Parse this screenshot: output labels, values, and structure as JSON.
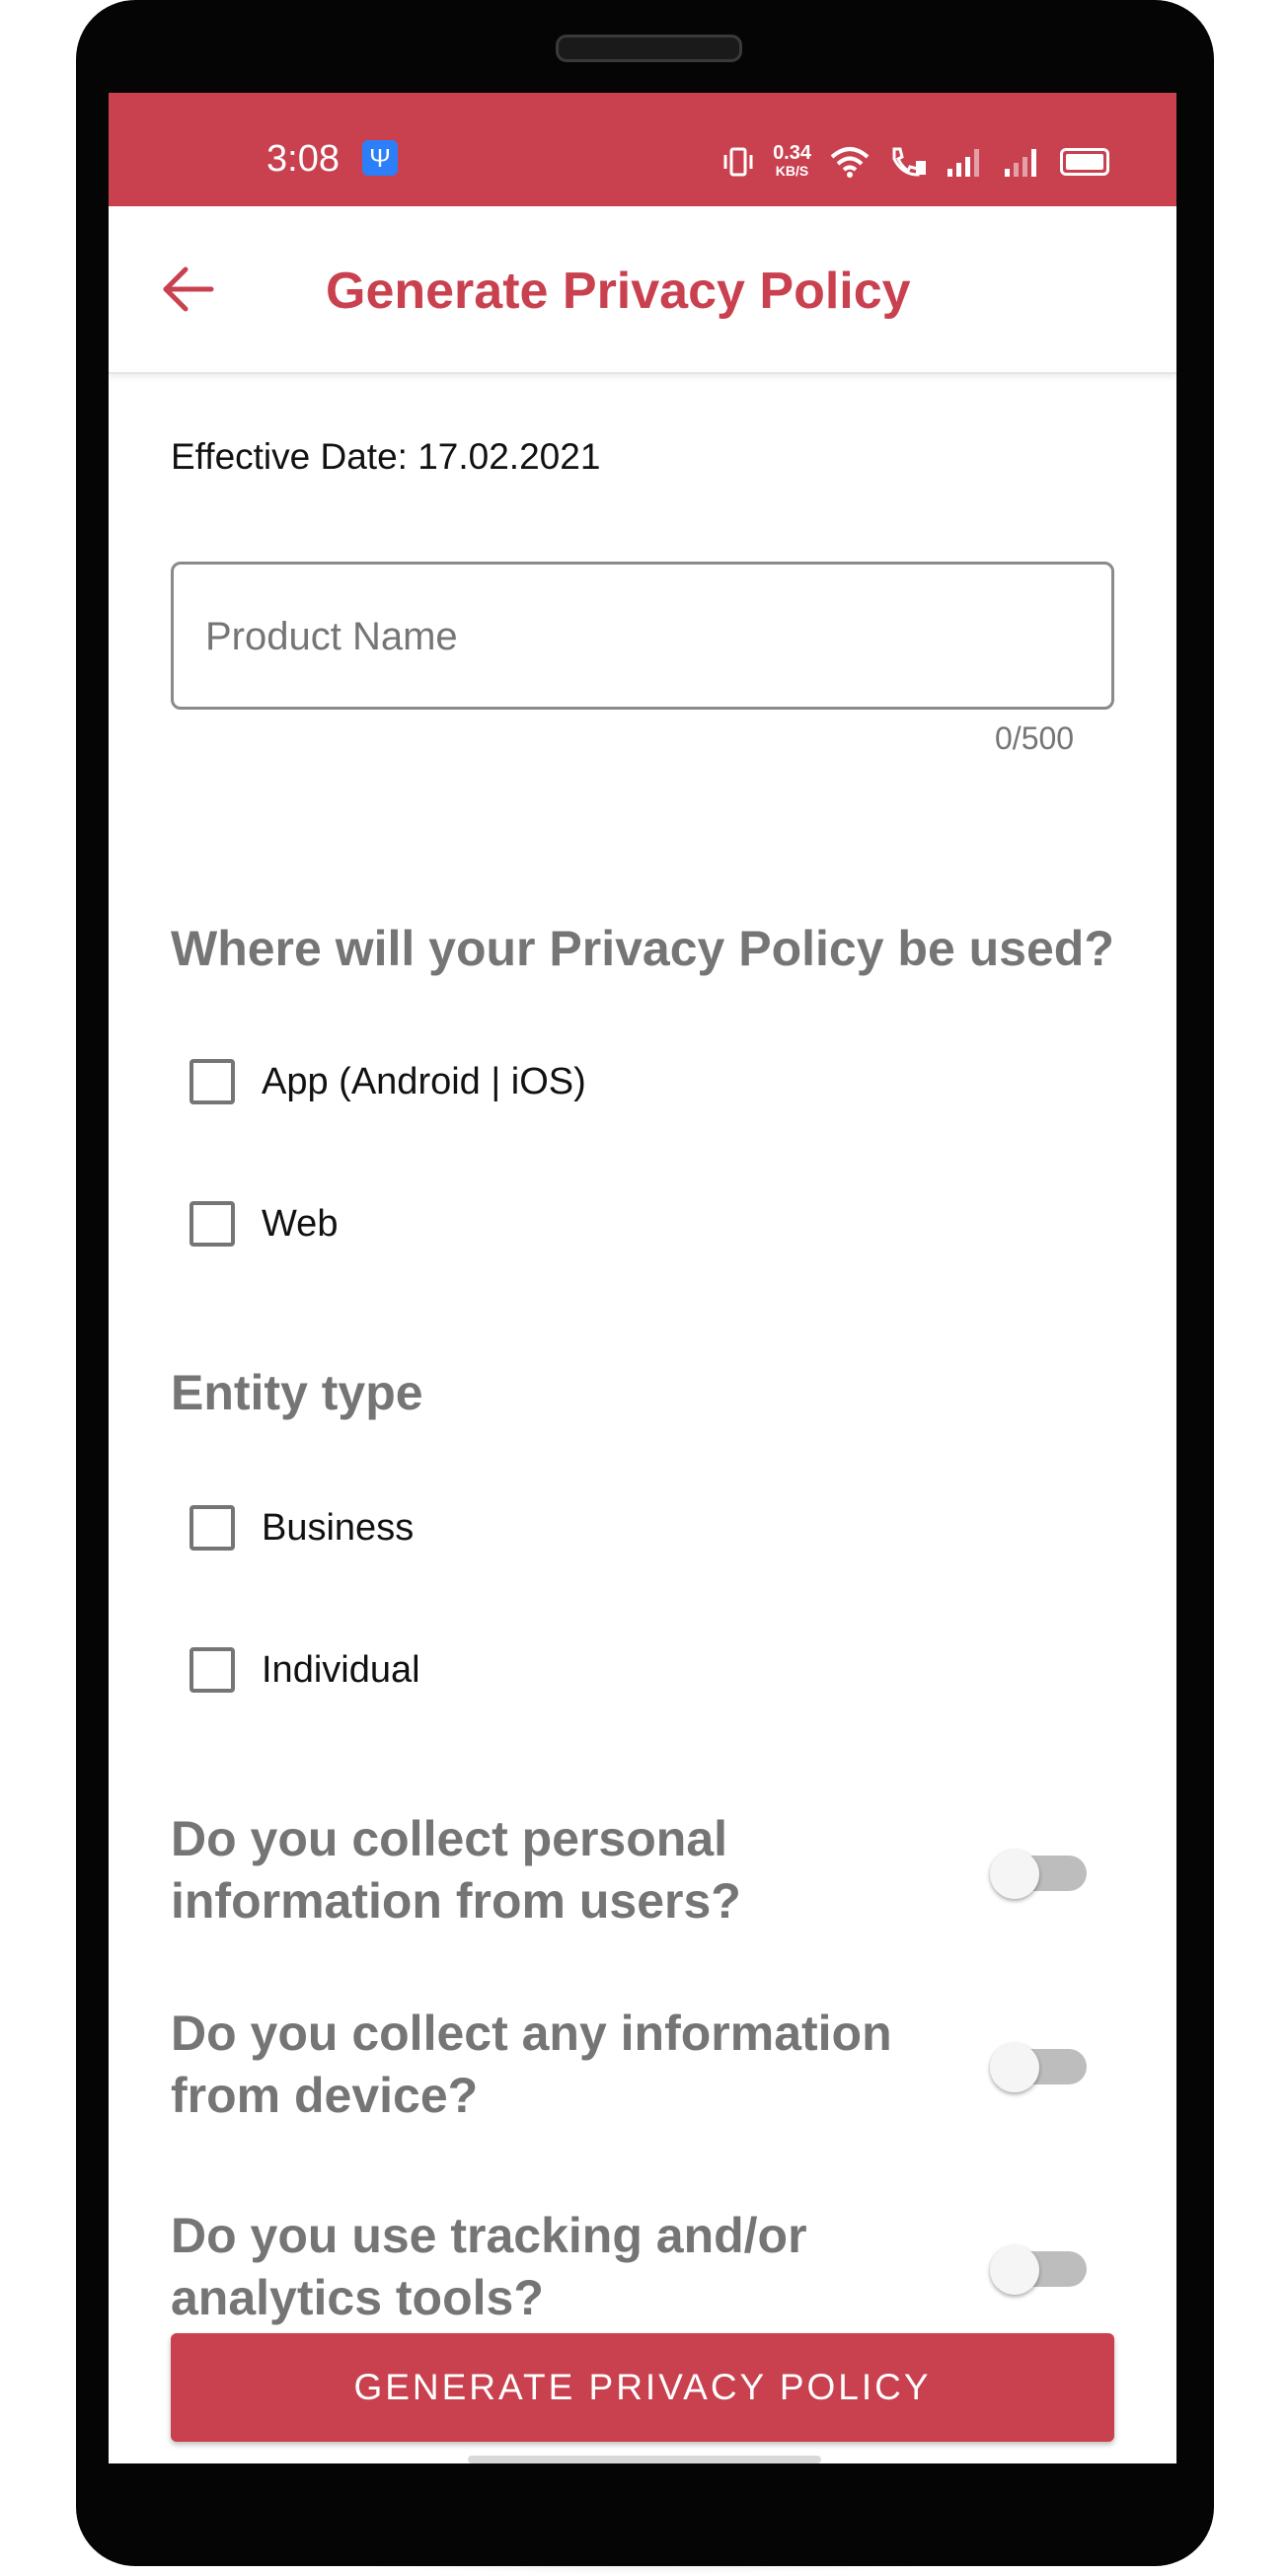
{
  "status_bar": {
    "time": "3:08",
    "net_speed": "0.34",
    "net_unit": "KB/S",
    "icons": [
      "usb-icon",
      "vibrate-icon",
      "wifi-icon",
      "wifi-calling-icon",
      "signal-icon",
      "signal-icon-2",
      "battery-icon"
    ],
    "background": "#c9404f"
  },
  "app_bar": {
    "title": "Generate Privacy Policy",
    "back_icon": "arrow-left-icon",
    "title_color": "#c9404f"
  },
  "form": {
    "effective_date": "Effective Date: 17.02.2021",
    "product_name": {
      "placeholder": "Product Name",
      "value": "",
      "counter": "0/500"
    },
    "usage_heading": "Where will your Privacy Policy be used?",
    "usage_options": [
      {
        "label": "App (Android | iOS)",
        "checked": false
      },
      {
        "label": "Web",
        "checked": false
      }
    ],
    "entity_heading": "Entity type",
    "entity_options": [
      {
        "label": "Business",
        "checked": false
      },
      {
        "label": "Individual",
        "checked": false
      }
    ],
    "toggles": [
      {
        "question": "Do you collect personal information from users?",
        "on": false
      },
      {
        "question": "Do you collect any information from device?",
        "on": false
      },
      {
        "question": "Do you use tracking and/or analytics tools?",
        "on": false
      }
    ],
    "submit_label": "GENERATE PRIVACY POLICY",
    "accent_color": "#c9404f"
  }
}
